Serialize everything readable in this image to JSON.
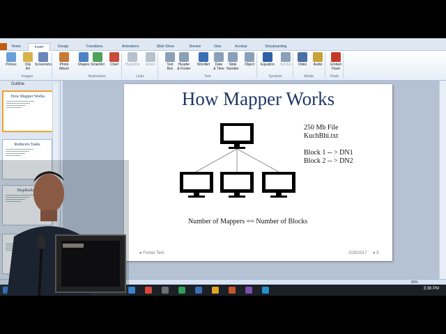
{
  "tabs": [
    "Home",
    "Insert",
    "Design",
    "Transitions",
    "Animations",
    "Slide Show",
    "Review",
    "View",
    "Acrobat",
    "Storyboarding"
  ],
  "active_tab": "Insert",
  "ribbon": {
    "buttons": [
      {
        "label": "Picture",
        "color": "#6a9fd8"
      },
      {
        "label": "Clip\nArt",
        "color": "#d8b24a"
      },
      {
        "label": "Screenshot",
        "color": "#6b86b8"
      },
      {
        "label": "Photo\nAlbum",
        "color": "#c77a3a"
      },
      {
        "label": "Shapes",
        "color": "#4d83c5"
      },
      {
        "label": "SmartArt",
        "color": "#4fa35a"
      },
      {
        "label": "Chart",
        "color": "#c54d3a"
      },
      {
        "label": "Hyperlink",
        "color": "#b7c1cc",
        "disabled": true
      },
      {
        "label": "Action",
        "color": "#b7c1cc",
        "disabled": true
      },
      {
        "label": "Text\nBox",
        "color": "#8aa0b8"
      },
      {
        "label": "Header\n& Footer",
        "color": "#8aa0b8"
      },
      {
        "label": "WordArt",
        "color": "#3a6fb5"
      },
      {
        "label": "Date\n& Time",
        "color": "#8aa0b8"
      },
      {
        "label": "Slide\nNumber",
        "color": "#8aa0b8"
      },
      {
        "label": "Object",
        "color": "#8aa0b8"
      },
      {
        "label": "Equation",
        "color": "#2f5fa8"
      },
      {
        "label": "Symbol",
        "color": "#8aa0b8",
        "disabled": true
      },
      {
        "label": "Video",
        "color": "#4a6fa5"
      },
      {
        "label": "Audio",
        "color": "#c9a33a"
      },
      {
        "label": "Embed\nFlash",
        "color": "#c43a2a"
      }
    ],
    "groups": [
      "Images",
      "Illustrations",
      "Links",
      "Text",
      "Symbols",
      "Media",
      "Flash"
    ]
  },
  "left_pane": {
    "outline_label": "Outline",
    "thumbnails": [
      {
        "title": "How Mapper Works",
        "selected": true
      },
      {
        "title": "Reducers Tasks",
        "selected": false
      },
      {
        "title": "MapReduce",
        "selected": false
      },
      {
        "title": "How M",
        "selected": false
      }
    ]
  },
  "slide": {
    "title": "How Mapper Works",
    "file_info": [
      "250 Mb File",
      "KuchBhi.txt"
    ],
    "blocks": [
      "Block 1 -- > DN1",
      "Block 2 -- > DN2"
    ],
    "caption": "Number of Mappers == Number of Blocks",
    "footer_text": "Footer Text",
    "date": "2/26/2017",
    "slide_number": "5"
  },
  "status": {
    "zoom": "80%"
  },
  "taskbar": {
    "time": "3:36 PM"
  }
}
